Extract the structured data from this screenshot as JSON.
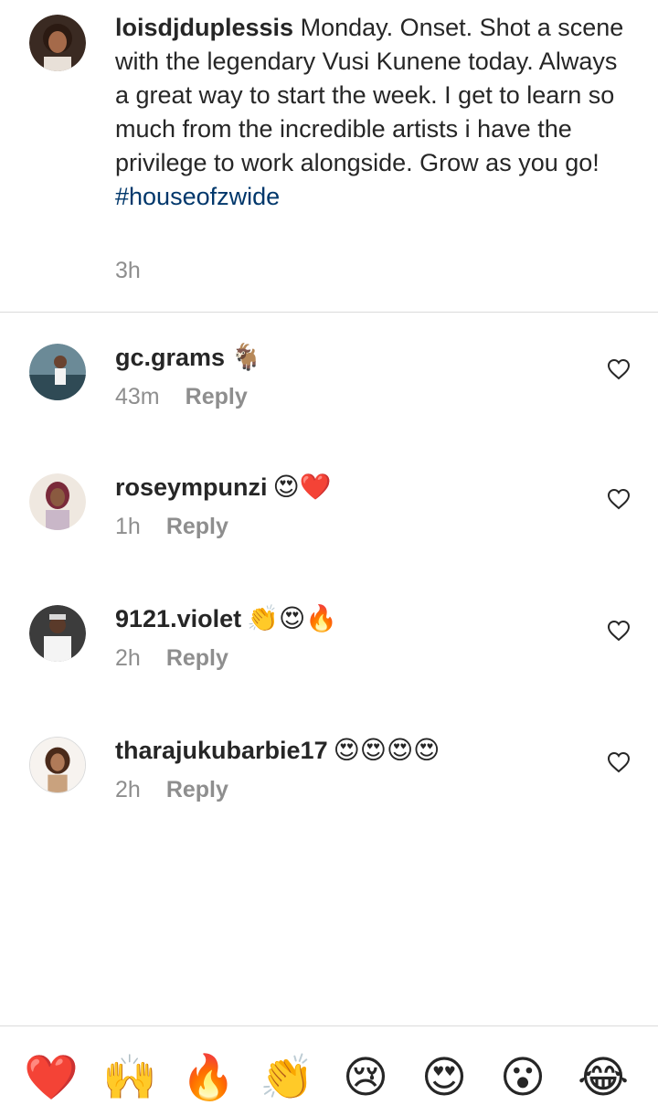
{
  "caption": {
    "username": "loisdjduplessis",
    "text": "Monday. Onset. Shot a scene with the legendary Vusi Kunene today. Always a great way to start the week. I get to learn so much from the incredible artists i have the privilege to work alongside. Grow as you go!",
    "hashtag": "#houseofzwide",
    "time": "3h"
  },
  "comments": [
    {
      "username": "gc.grams",
      "emoji": "🐐",
      "time": "43m",
      "reply_label": "Reply"
    },
    {
      "username": "roseympunzi",
      "emoji": "😍❤️",
      "time": "1h",
      "reply_label": "Reply"
    },
    {
      "username": "9121.violet",
      "emoji": "👏😍🔥",
      "time": "2h",
      "reply_label": "Reply"
    },
    {
      "username": "tharajukubarbie17",
      "emoji": "😍😍😍😍",
      "time": "2h",
      "reply_label": "Reply"
    }
  ],
  "reactions": [
    "❤️",
    "🙌",
    "🔥",
    "👏",
    "😢",
    "😍",
    "😮",
    "😂"
  ],
  "colors": {
    "text": "#262626",
    "muted": "#8e8e8e",
    "link": "#00376b",
    "divider": "#dbdbdb"
  }
}
